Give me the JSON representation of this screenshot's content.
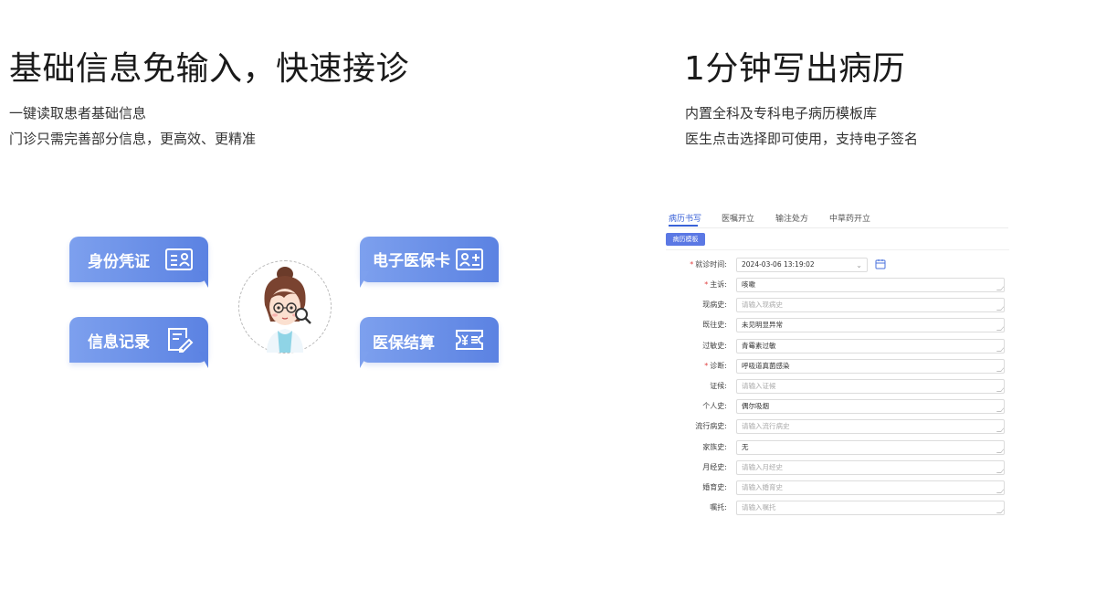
{
  "left": {
    "title": "基础信息免输入，快速接诊",
    "desc": [
      "一键读取患者基础信息",
      "门诊只需完善部分信息，更高效、更精准"
    ],
    "cards": [
      {
        "label": "身份凭证",
        "icon": "id-card-icon"
      },
      {
        "label": "信息记录",
        "icon": "edit-record-icon"
      },
      {
        "label": "电子医保卡",
        "icon": "insurance-card-icon"
      },
      {
        "label": "医保结算",
        "icon": "ticket-yen-icon"
      }
    ]
  },
  "right": {
    "title": "1分钟写出病历",
    "desc": [
      "内置全科及专科电子病历模板库",
      "医生点击选择即可使用，支持电子签名"
    ],
    "tabs": [
      "病历书写",
      "医嘱开立",
      "输注处方",
      "中草药开立"
    ],
    "template_button": "病历模板",
    "form": {
      "visit_time": {
        "label": "就诊时间:",
        "value": "2024-03-06 13:19:02",
        "required": true
      },
      "rows": [
        {
          "label": "主诉:",
          "value": "咳嗽",
          "placeholder": false,
          "required": true
        },
        {
          "label": "现病史:",
          "value": "请输入现病史",
          "placeholder": true,
          "required": false
        },
        {
          "label": "既往史:",
          "value": "未见明显异常",
          "placeholder": false,
          "required": false
        },
        {
          "label": "过敏史:",
          "value": "青霉素过敏",
          "placeholder": false,
          "required": false
        },
        {
          "label": "诊断:",
          "value": "呼吸道真菌感染",
          "placeholder": false,
          "required": true
        },
        {
          "label": "证候:",
          "value": "请输入证候",
          "placeholder": true,
          "required": false
        },
        {
          "label": "个人史:",
          "value": "偶尔吸烟",
          "placeholder": false,
          "required": false
        },
        {
          "label": "流行病史:",
          "value": "请输入流行病史",
          "placeholder": true,
          "required": false
        },
        {
          "label": "家族史:",
          "value": "无",
          "placeholder": false,
          "required": false
        },
        {
          "label": "月经史:",
          "value": "请输入月经史",
          "placeholder": true,
          "required": false
        },
        {
          "label": "婚育史:",
          "value": "请输入婚育史",
          "placeholder": true,
          "required": false
        },
        {
          "label": "嘱托:",
          "value": "请输入嘱托",
          "placeholder": true,
          "required": false
        }
      ]
    }
  },
  "colors": {
    "accent": "#5b82e2",
    "accent_light": "#7da0ee",
    "tab_active": "#3a62d8",
    "required": "#e04343"
  }
}
